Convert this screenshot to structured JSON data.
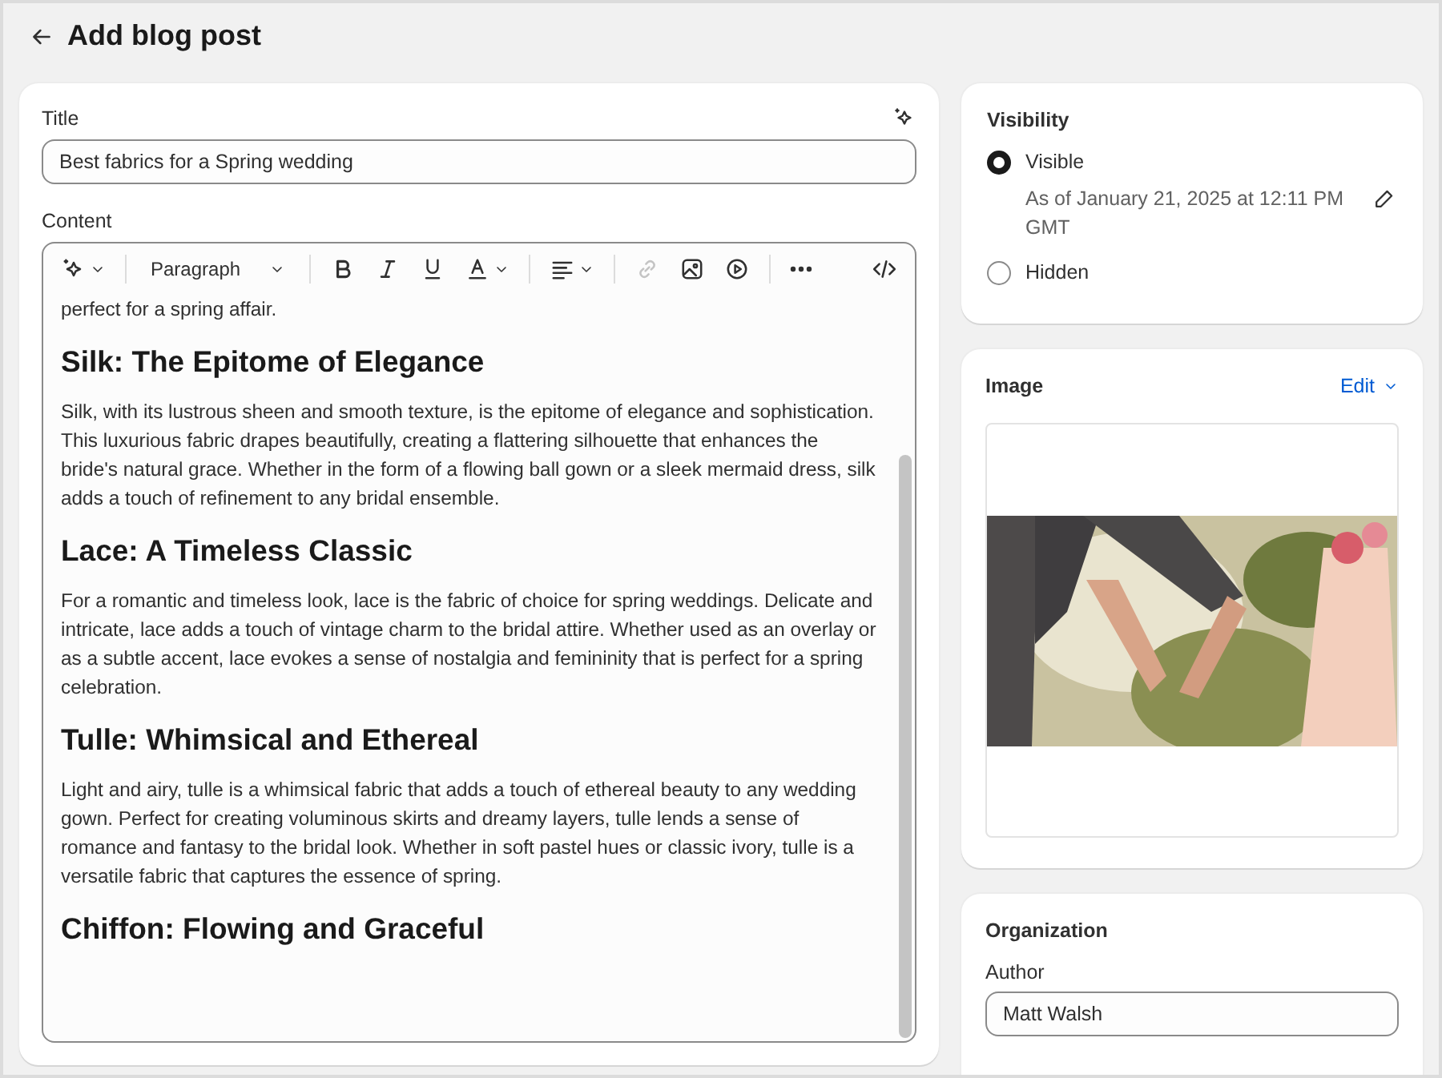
{
  "page": {
    "title": "Add blog post"
  },
  "title_field": {
    "label": "Title",
    "value": "Best fabrics for a Spring wedding"
  },
  "content": {
    "label": "Content",
    "toolbar": {
      "paragraph_style": "Paragraph",
      "link_disabled": true
    },
    "blocks": [
      {
        "kind": "paragraph",
        "text": "perfect for a spring affair."
      },
      {
        "kind": "heading",
        "text": "Silk: The Epitome of Elegance"
      },
      {
        "kind": "paragraph",
        "text": "Silk, with its lustrous sheen and smooth texture, is the epitome of elegance and sophistication. This luxurious fabric drapes beautifully, creating a flattering silhouette that enhances the bride's natural grace. Whether in the form of a flowing ball gown or a sleek mermaid dress, silk adds a touch of refinement to any bridal ensemble."
      },
      {
        "kind": "heading",
        "text": "Lace: A Timeless Classic"
      },
      {
        "kind": "paragraph",
        "text": "For a romantic and timeless look, lace is the fabric of choice for spring weddings. Delicate and intricate, lace adds a touch of vintage charm to the bridal attire. Whether used as an overlay or as a subtle accent, lace evokes a sense of nostalgia and femininity that is perfect for a spring celebration."
      },
      {
        "kind": "heading",
        "text": "Tulle: Whimsical and Ethereal"
      },
      {
        "kind": "paragraph",
        "text": "Light and airy, tulle is a whimsical fabric that adds a touch of ethereal beauty to any wedding gown. Perfect for creating voluminous skirts and dreamy layers, tulle lends a sense of romance and fantasy to the bridal look. Whether in soft pastel hues or classic ivory, tulle is a versatile fabric that captures the essence of spring."
      },
      {
        "kind": "heading",
        "text": "Chiffon: Flowing and Graceful"
      }
    ]
  },
  "visibility": {
    "title": "Visibility",
    "options": [
      {
        "label": "Visible",
        "selected": true,
        "detail": "As of January 21, 2025 at 12:11 PM GMT"
      },
      {
        "label": "Hidden",
        "selected": false
      }
    ]
  },
  "image": {
    "title": "Image",
    "action": "Edit",
    "kind": "picture"
  },
  "organization": {
    "title": "Organization",
    "author_label": "Author",
    "author": "Matt Walsh"
  }
}
